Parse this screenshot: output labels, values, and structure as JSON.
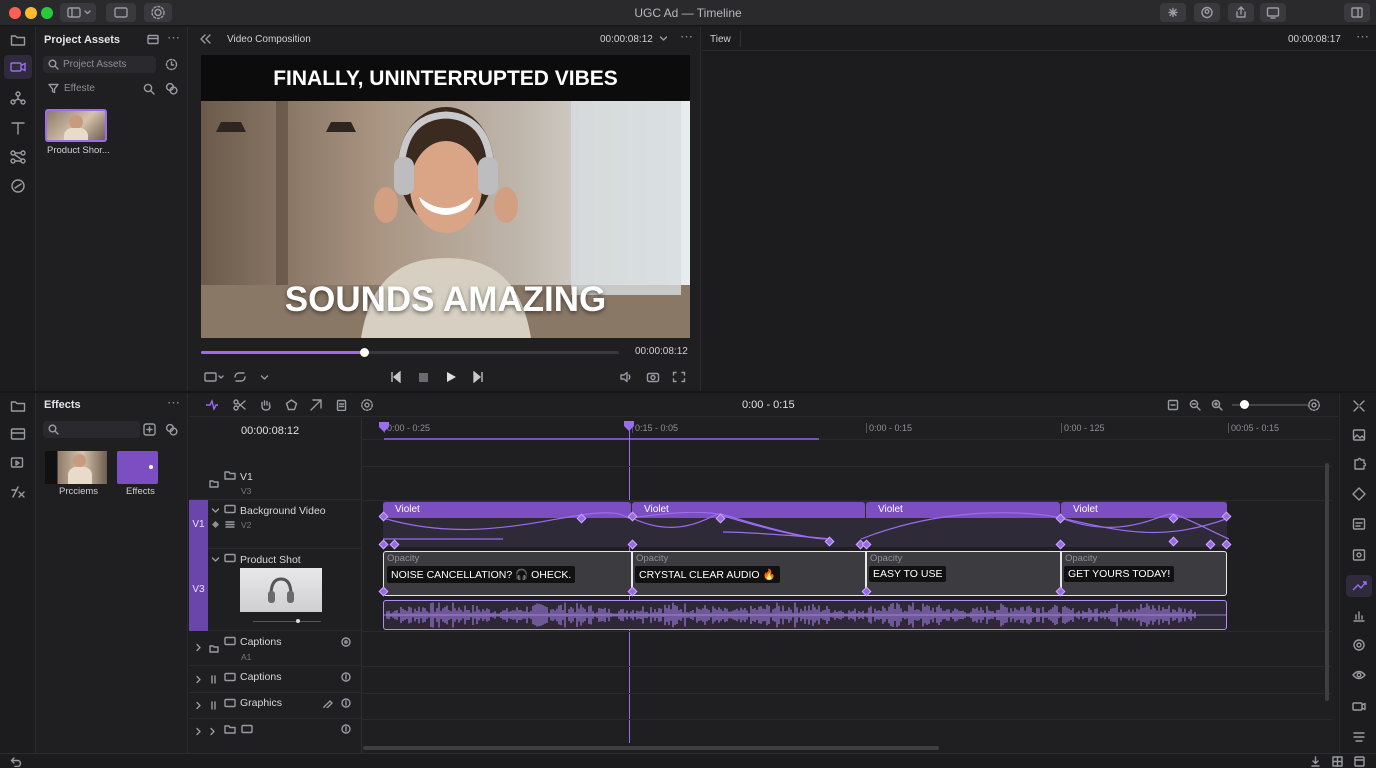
{
  "window": {
    "title": "UGC Ad — Timeline"
  },
  "assets_panel": {
    "title": "Project Assets",
    "search_placeholder": "Project Assets",
    "filter_placeholder": "Effeste",
    "items": [
      {
        "label": "Product Shor..."
      }
    ]
  },
  "viewer": {
    "title": "Video Composition",
    "timecode": "00:00:08:12",
    "caption_top": "FINALLY, UNINTERRUPTED VIBES",
    "caption_mid": "SOUNDS AMAZING",
    "scrub_timecode": "00:00:08:12",
    "scrub_progress": 0.39
  },
  "second_viewer": {
    "title": "Tiew",
    "timecode": "00:00:08:17"
  },
  "effects_panel": {
    "title": "Effects",
    "items": [
      {
        "label": "Prcciems"
      },
      {
        "label": "Effects"
      }
    ]
  },
  "timeline": {
    "range": "0:00 - 0:15",
    "current_timecode": "00:00:08:12",
    "zoom_level": 0.15,
    "ruler": [
      "0:00 - 0:25",
      "0:15 - 0:05",
      "0:00 - 0:15",
      "0:00 - 125",
      "00:05 - 0:15"
    ],
    "tracks": [
      {
        "name": "V1",
        "sub": "V3"
      },
      {
        "name": "Background Video",
        "sub": "V2",
        "badge": "V1"
      },
      {
        "name": "Product Shot",
        "badge": "V3"
      },
      {
        "name": "Captions",
        "sub": "A1"
      },
      {
        "name": "Captions"
      },
      {
        "name": "Graphics"
      },
      {
        "name": ""
      }
    ],
    "violet_clips": [
      "Violet",
      "Violet",
      "Violet",
      "Violet"
    ],
    "opacity_label": "Opacity",
    "opacity_labels": [
      "Opacity",
      "Opacity",
      "Opacity",
      "Opacity"
    ],
    "captions": [
      "NOISE CANCELLATION? 🎧 OHECK.",
      "CRYSTAL CLEAR AUDIO 🔥",
      "EASY TO USE",
      "GET YOURS TODAY!"
    ]
  },
  "colors": {
    "accent": "#7b4fc2",
    "playhead": "#9b6cf0"
  }
}
